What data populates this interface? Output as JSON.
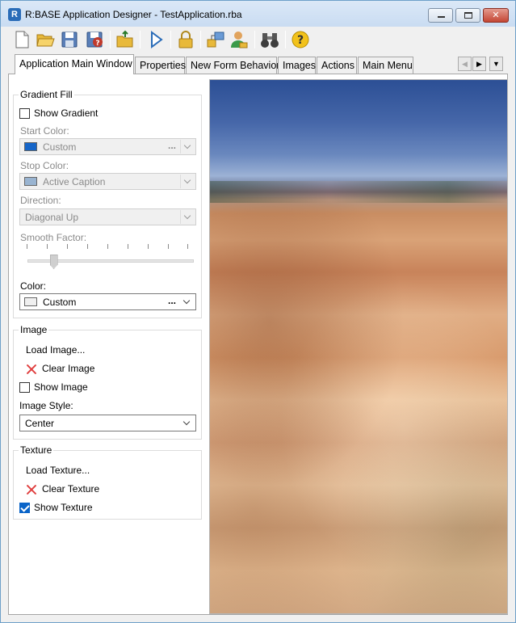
{
  "window": {
    "title": "R:BASE Application Designer - TestApplication.rba"
  },
  "toolbar": {
    "icons": [
      "new-file-icon",
      "open-folder-icon",
      "save-icon",
      "save-as-icon",
      "open-project-icon",
      "run-icon",
      "lock-icon",
      "organize-icon",
      "user-icon",
      "binoculars-icon",
      "help-icon"
    ]
  },
  "tabs": [
    {
      "label": "Application Main Window"
    },
    {
      "label": "Properties"
    },
    {
      "label": "New Form Behavior"
    },
    {
      "label": "Images"
    },
    {
      "label": "Actions"
    },
    {
      "label": "Main Menu"
    }
  ],
  "gradient_fill": {
    "title": "Gradient Fill",
    "show_gradient_label": "Show Gradient",
    "show_gradient_checked": false,
    "start_color_label": "Start Color:",
    "start_color_value": "Custom",
    "start_color_swatch": "#1565c8",
    "stop_color_label": "Stop Color:",
    "stop_color_value": "Active Caption",
    "stop_color_swatch": "#99b4d1",
    "direction_label": "Direction:",
    "direction_value": "Diagonal Up",
    "smooth_factor_label": "Smooth Factor:",
    "smooth_factor_level": 0.1,
    "color_label": "Color:",
    "color_value": "Custom",
    "color_swatch": "#f0f0f0",
    "dots": "..."
  },
  "image": {
    "title": "Image",
    "load_label": "Load Image...",
    "clear_label": "Clear Image",
    "show_label": "Show Image",
    "show_checked": false,
    "style_label": "Image Style:",
    "style_value": "Center"
  },
  "texture": {
    "title": "Texture",
    "load_label": "Load Texture...",
    "clear_label": "Clear Texture",
    "show_label": "Show Texture",
    "show_checked": true
  }
}
